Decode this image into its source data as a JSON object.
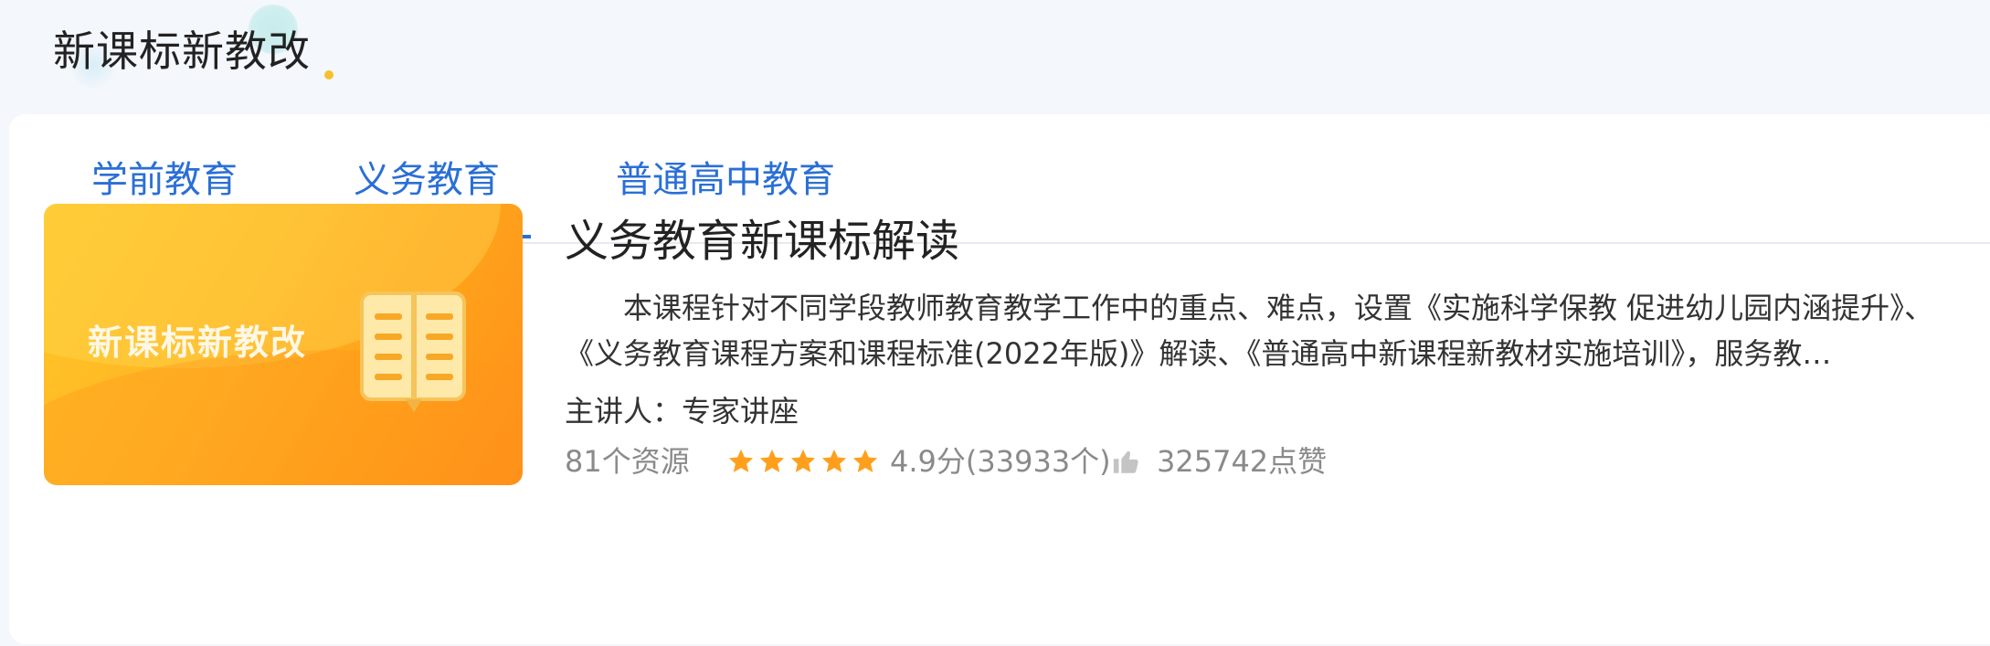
{
  "header": {
    "title": "新课标新教改"
  },
  "tabs": [
    {
      "label": "学前教育",
      "active": false
    },
    {
      "label": "义务教育",
      "active": true
    },
    {
      "label": "普通高中教育",
      "active": false
    }
  ],
  "course": {
    "thumbnail_text": "新课标新教改",
    "title": "义务教育新课标解读",
    "description": "本课程针对不同学段教师教育教学工作中的重点、难点，设置《实施科学保教 促进幼儿园内涵提升》、《义务教育课程方案和课程标准(2022年版)》解读、《普通高中新课程新教材实施培训》，服务教…",
    "speaker": "主讲人：专家讲座",
    "resources": "81个资源",
    "rating_stars": 5,
    "rating": "4.9分(33933个)",
    "likes": "325742点赞"
  },
  "colors": {
    "accent": "#2a6fd6",
    "star": "#ff9f1c",
    "thumbnail": "#ffb524"
  },
  "icons": {
    "star": "star-icon",
    "like": "thumb-up-icon",
    "book": "book-icon"
  }
}
